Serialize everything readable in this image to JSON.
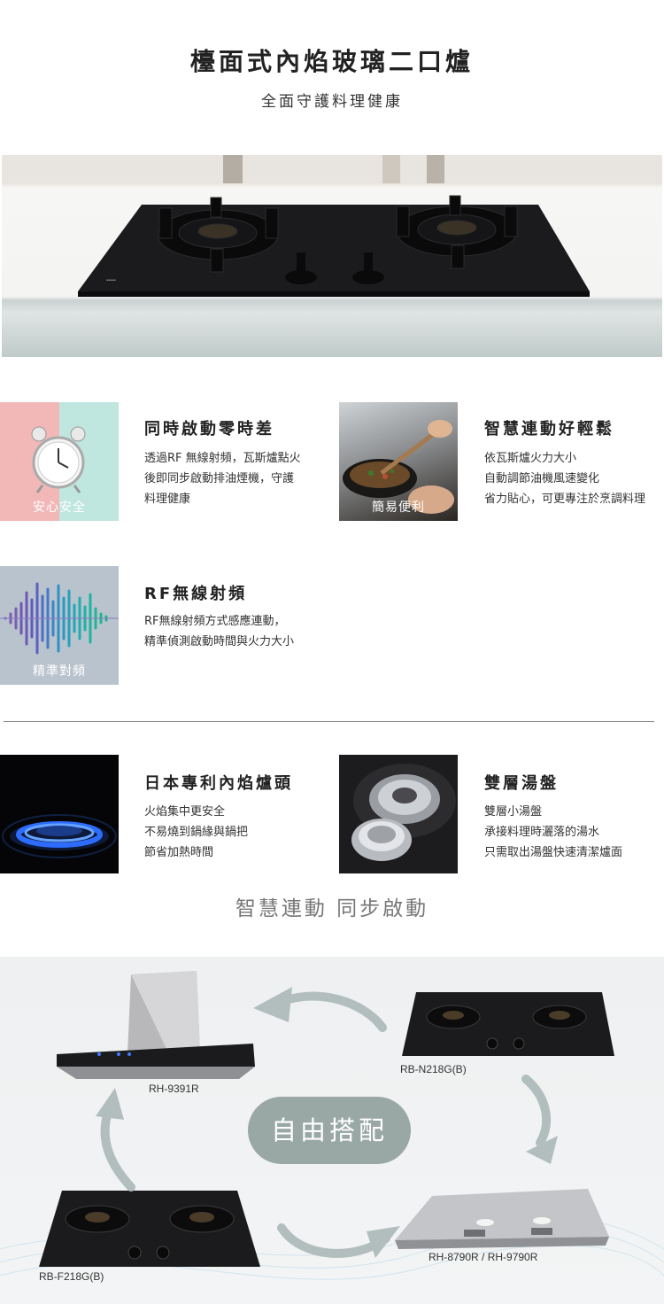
{
  "header": {
    "title": "檯面式內焰玻璃二口爐",
    "subtitle": "全面守護料理健康"
  },
  "features_top": [
    {
      "title": "同時啟動零時差",
      "badge": "安心安全",
      "body": "透過RF 無線射頻，瓦斯爐點火\n後即同步啟動排油煙機，守護\n料理健康"
    },
    {
      "title": "智慧連動好輕鬆",
      "badge": "簡易便利",
      "body": "依瓦斯爐火力大小\n自動調節油機風速變化\n省力貼心，可更專注於烹調料理"
    },
    {
      "title": "RF無線射頻",
      "badge": "精準對頻",
      "body": "RF無線射頻方式感應連動，\n精準偵測啟動時間與火力大小"
    }
  ],
  "features_bottom": [
    {
      "title": "日本專利內焰爐頭",
      "body": "火焰集中更安全\n不易燒到鍋緣與鍋把\n節省加熱時間"
    },
    {
      "title": "雙層湯盤",
      "body": "雙層小湯盤\n承接料理時灑落的湯水\n只需取出湯盤快速清潔爐面"
    }
  ],
  "slogan": "智慧連動 同步啟動",
  "combo": {
    "center_label": "自由搭配",
    "models": [
      "RH-9391R",
      "RB-N218G(B)",
      "RB-F218G(B)",
      "RH-8790R / RH-9790R"
    ]
  },
  "colors": {
    "pink": "#f2b8b8",
    "mint": "#bfe6df",
    "steel": "#b9c3ce",
    "pill": "#9aa8a5",
    "arrow": "#b2bebd",
    "flame": "#2d6cff"
  },
  "icons": [
    "alarm-clock-icon",
    "sound-wave-icon",
    "circular-arrow-icon"
  ]
}
